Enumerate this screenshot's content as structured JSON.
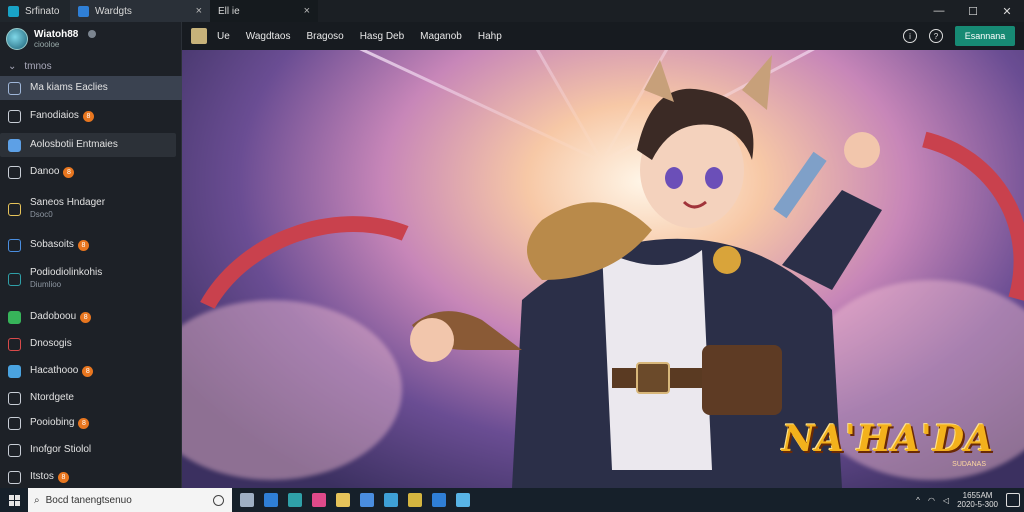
{
  "titlebar": {
    "tabs": [
      {
        "label": "Srfinato",
        "close": ""
      },
      {
        "label": "Wardgts",
        "close": "×"
      },
      {
        "label": "Ell ie",
        "close": "×"
      }
    ],
    "window_controls": {
      "minimize": "—",
      "maximize": "☐",
      "close": "✕"
    }
  },
  "sidebar": {
    "profile": {
      "name": "Wiatoh88",
      "sub": "ciooloe"
    },
    "collapse_label": "tmnos",
    "items": [
      {
        "label": "Ma kiams Eaclies",
        "sub": "",
        "badge": "",
        "icon": "monitor-icon",
        "icon_color": "#9fb6d8"
      },
      {
        "label": "Fanodiaios",
        "sub": "",
        "badge": "8",
        "icon": "window-icon",
        "icon_color": "#c9ced6"
      },
      {
        "label": "Aolosbotii Entmaies",
        "sub": "",
        "badge": "",
        "icon": "app-icon",
        "icon_color": "#5da0e6"
      },
      {
        "label": "Danoo",
        "sub": "",
        "badge": "8",
        "icon": "globe-icon",
        "icon_color": "#c9ced6"
      },
      {
        "label": "Saneos Hndager",
        "sub": "Dsoc0",
        "badge": "",
        "icon": "pencil-icon",
        "icon_color": "#e6c35a"
      },
      {
        "label": "Sobasoits",
        "sub": "",
        "badge": "8",
        "icon": "wrench-icon",
        "icon_color": "#4a8ee0"
      },
      {
        "label": "Podiodiolinkohis",
        "sub": "Diumlioo",
        "badge": "",
        "icon": "earth-icon",
        "icon_color": "#2fa0a8"
      },
      {
        "label": "Dadoboou",
        "sub": "",
        "badge": "8",
        "icon": "chart-icon",
        "icon_color": "#37b45a"
      },
      {
        "label": "Dnosogis",
        "sub": "",
        "badge": "",
        "icon": "document-icon",
        "icon_color": "#d94a4a"
      },
      {
        "label": "Hacathooo",
        "sub": "",
        "badge": "8",
        "icon": "photos-icon",
        "icon_color": "#4aa3e0"
      },
      {
        "label": "Ntordgete",
        "sub": "",
        "badge": "",
        "icon": "folder-icon",
        "icon_color": "#c9ced6"
      },
      {
        "label": "Pooiobing",
        "sub": "",
        "badge": "8",
        "icon": "notes-icon",
        "icon_color": "#c9ced6"
      },
      {
        "label": "Inofgor Stiolol",
        "sub": "",
        "badge": "",
        "icon": "terminal-icon",
        "icon_color": "#c9ced6"
      },
      {
        "label": "Itstos",
        "sub": "",
        "badge": "8",
        "icon": "settings-icon",
        "icon_color": "#c9ced6"
      }
    ]
  },
  "toolbar": {
    "menu": [
      "Ue",
      "Wagdtaos",
      "Bragoso",
      "Hasg Deb",
      "Maganob",
      "Hahp"
    ],
    "button_label": "Esannana"
  },
  "main": {
    "logo_text": "NA'HA'DA",
    "logo_sub": "SUDANAS"
  },
  "taskbar": {
    "search_placeholder": "Bocd tanengtsenuo",
    "app_colors": [
      "#9fb0c4",
      "#2f7fd6",
      "#2fa0a8",
      "#e04a8a",
      "#e6c35a",
      "#4a8ee0",
      "#3ea0d6",
      "#d4b640",
      "#2f7fd6",
      "#58b4e6"
    ],
    "clock_time": "1655AM",
    "clock_date": "2020-5-300"
  },
  "colors": {
    "accent": "#178a74",
    "badge": "#e8761f",
    "selected_nav": "#3a4250"
  }
}
